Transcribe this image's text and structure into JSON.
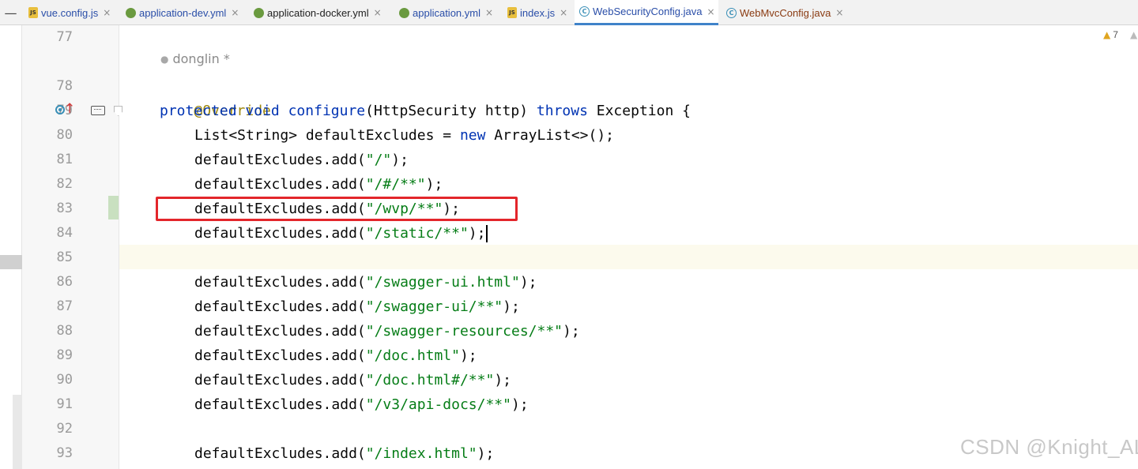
{
  "tabs": [
    {
      "label": "vue.config.js",
      "icon": "js-file-icon",
      "active": false
    },
    {
      "label": "application-dev.yml",
      "icon": "yml-file-icon",
      "active": false
    },
    {
      "label": "application-docker.yml",
      "icon": "yml-file-icon",
      "active": false
    },
    {
      "label": "application.yml",
      "icon": "yml-file-icon",
      "active": false
    },
    {
      "label": "index.js",
      "icon": "js-file-icon",
      "active": false
    },
    {
      "label": "WebSecurityConfig.java",
      "icon": "java-class-icon",
      "active": true
    },
    {
      "label": "WebMvcConfig.java",
      "icon": "java-class-icon",
      "active": false
    }
  ],
  "tab_bar": {
    "minimize_symbol": "—",
    "close_symbol": "×"
  },
  "editor": {
    "author_hint": "donglin *",
    "warnings_count": "7",
    "line_numbers": [
      "77",
      "78",
      "79",
      "80",
      "81",
      "82",
      "83",
      "84",
      "85",
      "86",
      "87",
      "88",
      "89",
      "90",
      "91",
      "92",
      "93"
    ],
    "code": {
      "l78": "@Override",
      "l79_kw1": "protected",
      "l79_kw2": "void",
      "l79_rest1": "configure",
      "l79_rest2": "(HttpSecurity http) ",
      "l79_kw3": "throws",
      "l79_rest3": " Exception {",
      "l80_a": "List<String> defaultExcludes = ",
      "l80_kw": "new",
      "l80_b": " ArrayList<>();",
      "add_call": "defaultExcludes.add(",
      "close": ");",
      "strings": {
        "l81": "\"/\"",
        "l82": "\"/#/**\"",
        "l83": "\"/wvp/**\"",
        "l84": "\"/static/**\"",
        "l86": "\"/swagger-ui.html\"",
        "l87": "\"/swagger-ui/**\"",
        "l88": "\"/swagger-resources/**\"",
        "l89": "\"/doc.html\"",
        "l90": "\"/doc.html#/**\"",
        "l91": "\"/v3/api-docs/**\"",
        "l93": "\"/index.html\""
      }
    }
  },
  "watermark": "CSDN @Knight_AL",
  "colors": {
    "keyword": "#0033b3",
    "string": "#067d17",
    "annotation": "#9e880d",
    "highlight_box": "#e3262b",
    "active_tab_underline": "#4083c9"
  }
}
